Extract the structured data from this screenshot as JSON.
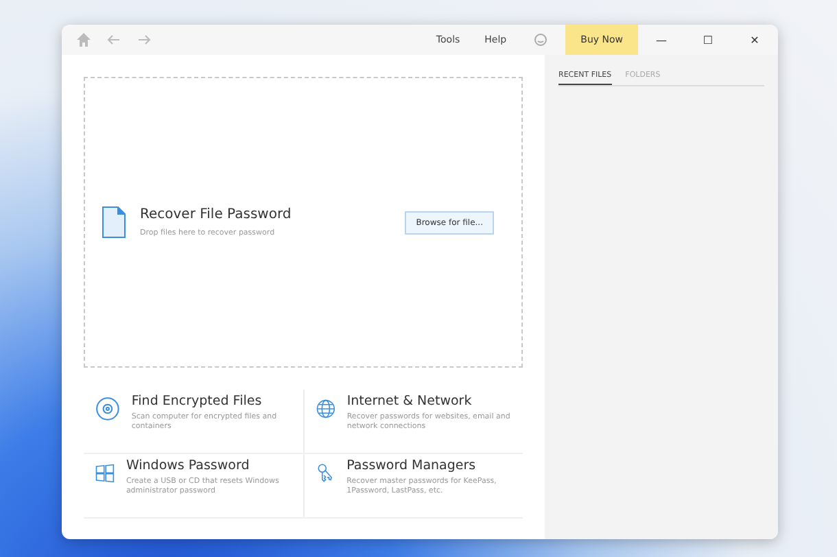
{
  "toolbar": {
    "menu": [
      "Tools",
      "Help"
    ],
    "buy_button": "Buy Now",
    "window_buttons": [
      "—",
      "☐",
      "✕"
    ]
  },
  "dropzone": {
    "title": "Recover File Password",
    "hint": "Drop files here to recover password",
    "button": "Browse for file..."
  },
  "tools": [
    {
      "kind": "disc",
      "title": "Find Encrypted Files",
      "description": "Scan computer for encrypted files and containers"
    },
    {
      "kind": "globe",
      "title": "Internet & Network",
      "description": "Recover passwords for websites, email and network connections"
    },
    {
      "kind": "windows",
      "title": "Windows Password",
      "description": "Create a USB or CD that resets Windows administrator password"
    },
    {
      "kind": "keys",
      "title": "Password Managers",
      "description": "Recover master passwords for KeePass, 1Password, LastPass, etc."
    }
  ],
  "sidebar": {
    "tabs": [
      {
        "label": "RECENT FILES",
        "selected": true
      },
      {
        "label": "FOLDERS",
        "selected": false
      }
    ]
  }
}
